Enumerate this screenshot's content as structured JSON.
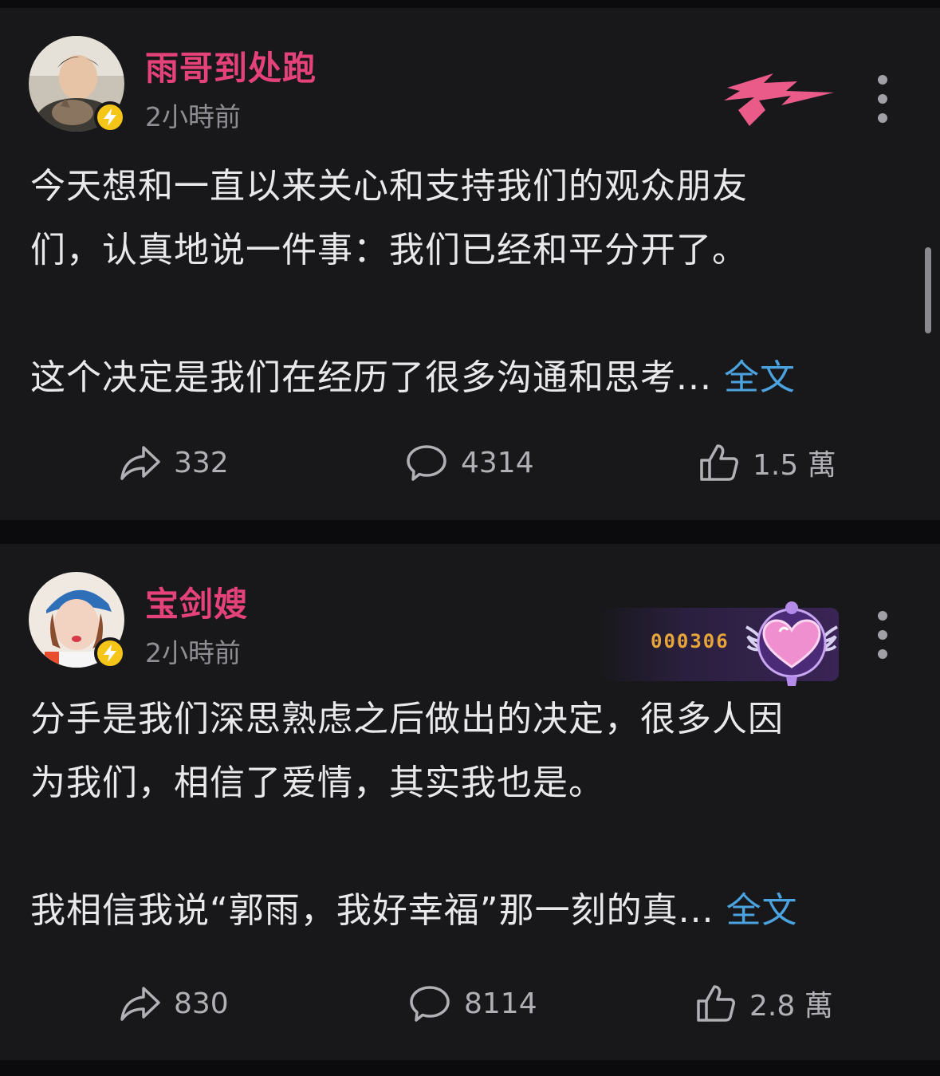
{
  "posts": [
    {
      "username": "雨哥到处跑",
      "time": "2小時前",
      "body_lines": [
        "今天想和一直以来关心和支持我们的观众朋友",
        "们，认真地说一件事：我们已经和平分开了。",
        "",
        "这个决定是我们在经历了很多沟通和思考..."
      ],
      "full_text_label": "全文",
      "shares": "332",
      "comments": "4314",
      "likes": "1.5 萬",
      "header_badge_icon": "team-logo-icon"
    },
    {
      "username": "宝剑嫂",
      "time": "2小時前",
      "body_lines": [
        "分手是我们深思熟虑之后做出的决定，很多人因",
        "为我们，相信了爱情，其实我也是。",
        "",
        "我相信我说“郭雨，我好幸福”那一刻的真..."
      ],
      "full_text_label": "全文",
      "shares": "830",
      "comments": "8114",
      "likes": "2.8 萬",
      "header_badge_icon": "fan-badge-heart-icon",
      "fan_badge_number": "000306"
    }
  ],
  "colors": {
    "username": "#e6427a",
    "link": "#4aa3df",
    "verify_badge": "#f5c518",
    "background": "#18181b"
  }
}
